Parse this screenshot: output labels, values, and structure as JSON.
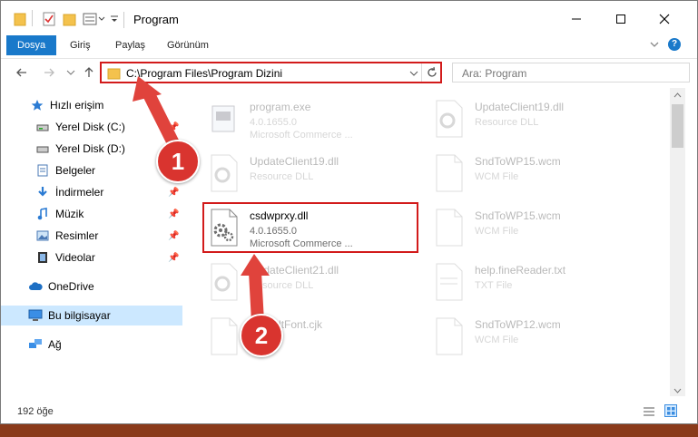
{
  "window": {
    "title": "Program"
  },
  "ribbon": {
    "tabs": [
      "Dosya",
      "Giriş",
      "Paylaş",
      "Görünüm"
    ]
  },
  "address": {
    "path": "C:\\Program Files\\Program Dizini",
    "search_placeholder": "Ara: Program"
  },
  "nav": {
    "items": [
      {
        "label": "Hızlı erişim",
        "icon": "star-icon"
      },
      {
        "label": "Yerel Disk (C:)",
        "icon": "drive-icon",
        "pinned": true
      },
      {
        "label": "Yerel Disk (D:)",
        "icon": "drive-icon",
        "pinned": true
      },
      {
        "label": "Belgeler",
        "icon": "documents-icon",
        "pinned": true
      },
      {
        "label": "İndirmeler",
        "icon": "download-icon",
        "pinned": true
      },
      {
        "label": "Müzik",
        "icon": "music-icon",
        "pinned": true
      },
      {
        "label": "Resimler",
        "icon": "pictures-icon",
        "pinned": true
      },
      {
        "label": "Videolar",
        "icon": "videos-icon",
        "pinned": true
      },
      {
        "label": "OneDrive",
        "icon": "cloud-icon"
      },
      {
        "label": "Bu bilgisayar",
        "icon": "computer-icon",
        "selected": true
      },
      {
        "label": "Ağ",
        "icon": "network-icon"
      }
    ]
  },
  "files": [
    {
      "name": "program.exe",
      "line1": "4.0.1655.0",
      "line2": "Microsoft Commerce ..."
    },
    {
      "name": "UpdateClient19.dll",
      "line1": "Resource DLL",
      "line2": ""
    },
    {
      "name": "UpdateClient19.dll",
      "line1": "Resource DLL",
      "line2": ""
    },
    {
      "name": "SndToWP15.wcm",
      "line1": "WCM File",
      "line2": ""
    },
    {
      "name": "csdwprxy.dll",
      "line1": "4.0.1655.0",
      "line2": "Microsoft Commerce ..."
    },
    {
      "name": "SndToWP15.wcm",
      "line1": "WCM File",
      "line2": ""
    },
    {
      "name": "UpdateClient21.dll",
      "line1": "Resource DLL",
      "line2": ""
    },
    {
      "name": "help.fineReader.txt",
      "line1": "TXT File",
      "line2": ""
    },
    {
      "name": "DefaultFont.cjk",
      "line1": "",
      "line2": ""
    },
    {
      "name": "SndToWP12.wcm",
      "line1": "WCM File",
      "line2": ""
    }
  ],
  "status": {
    "count": "192 öğe"
  },
  "annotations": {
    "step1": "1",
    "step2": "2"
  },
  "colors": {
    "accent": "#1979ca",
    "highlight": "#d21b1b",
    "badge": "#d9342f",
    "selected": "#cce8ff"
  }
}
